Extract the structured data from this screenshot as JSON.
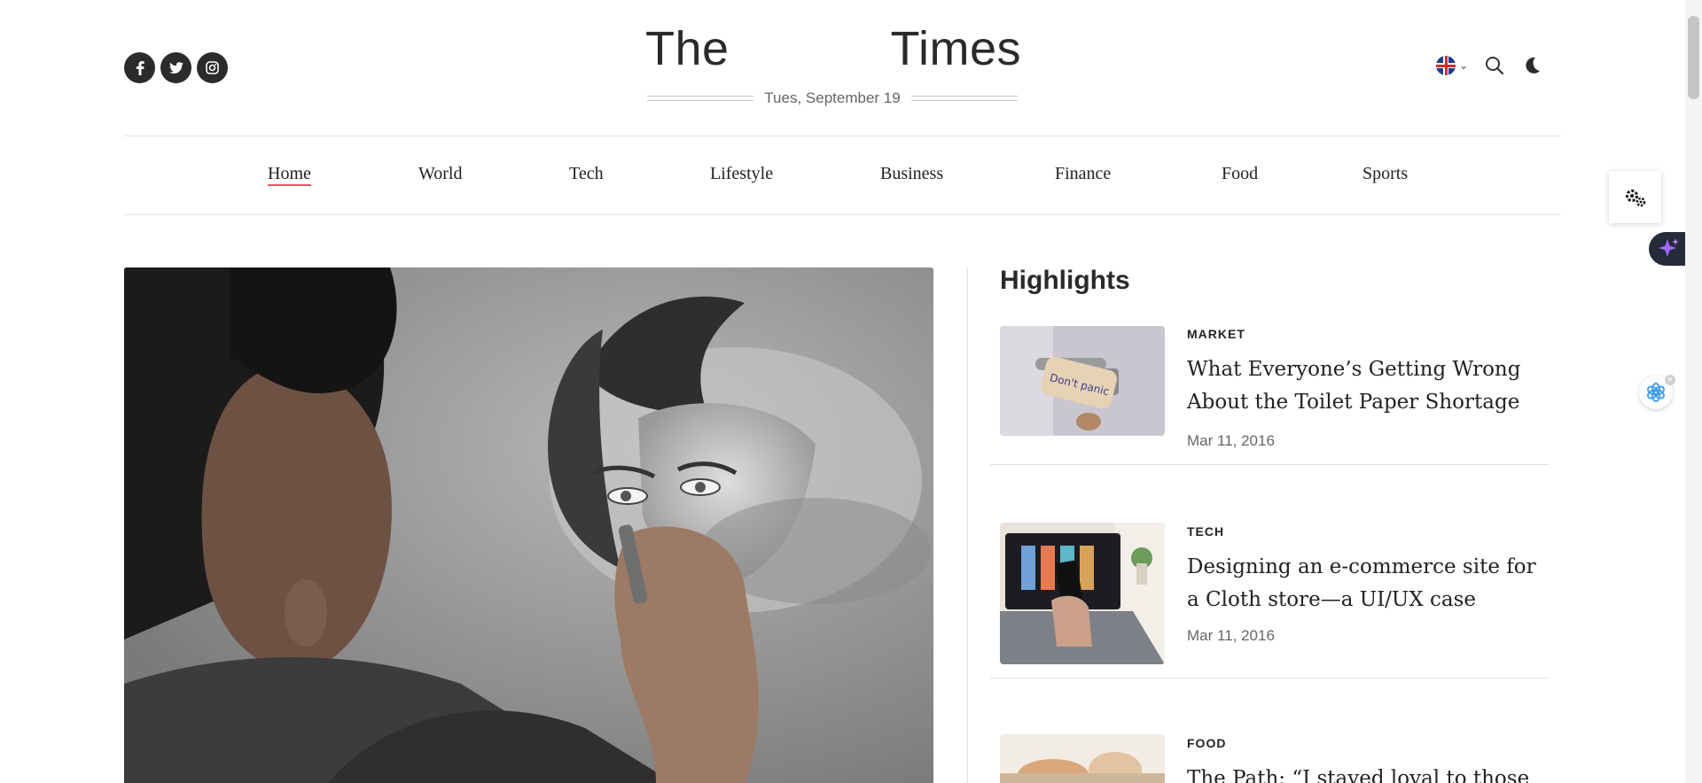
{
  "header": {
    "logo_left": "The",
    "logo_right": "Times",
    "date": "Tues, September 19"
  },
  "social": [
    {
      "name": "facebook-icon",
      "glyph": "f"
    },
    {
      "name": "twitter-icon",
      "glyph": "t"
    },
    {
      "name": "instagram-icon",
      "glyph": "◎"
    }
  ],
  "nav": [
    {
      "label": "Home",
      "active": true
    },
    {
      "label": "World"
    },
    {
      "label": "Tech"
    },
    {
      "label": "Lifestyle"
    },
    {
      "label": "Business"
    },
    {
      "label": "Finance"
    },
    {
      "label": "Food"
    },
    {
      "label": "Sports"
    }
  ],
  "highlights": {
    "title": "Highlights",
    "items": [
      {
        "category": "MARKET",
        "title": "What Everyone’s Getting Wrong About the Toilet Paper Shortage",
        "date": "Mar 11, 2016",
        "thumb_text": "Don't panic"
      },
      {
        "category": "TECH",
        "title": "Designing an e-commerce site for a Cloth store—a UI/UX case",
        "date": "Mar 11, 2016"
      },
      {
        "category": "FOOD",
        "title": "The Path: “I stayed loyal to those",
        "date": ""
      }
    ]
  },
  "colors": {
    "accent_underline": "#e25a5a",
    "social_bg": "#2b2b2b",
    "spark": "#8a5cf6"
  }
}
